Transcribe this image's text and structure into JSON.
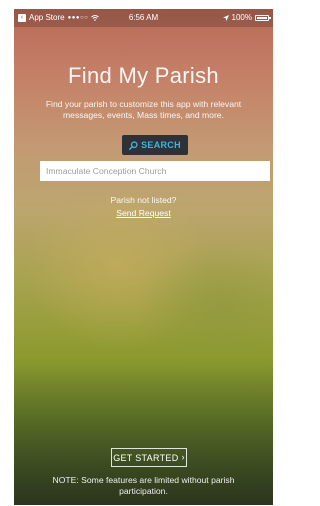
{
  "status_bar": {
    "back_label": "App Store",
    "signal": "●●●○○",
    "time": "6:56 AM",
    "battery": "100%"
  },
  "screen": {
    "title": "Find My Parish",
    "subtitle": "Find your parish to customize this app with relevant messages, events, Mass times, and more.",
    "search_button_label": "SEARCH",
    "search_input_value": "Immaculate Conception Church",
    "not_listed_text": "Parish not listed?",
    "send_request_label": "Send Request",
    "get_started_label": "GET STARTED",
    "note": "NOTE: Some features are limited without parish participation."
  },
  "colors": {
    "search_accent": "#3fb3e2",
    "search_button_bg": "#2e3238"
  },
  "icons": {
    "search": "search-icon",
    "chevron": "chevron-right-icon",
    "back": "back-chevron-icon",
    "wifi": "wifi-icon",
    "location": "location-arrow-icon",
    "battery": "battery-icon"
  }
}
